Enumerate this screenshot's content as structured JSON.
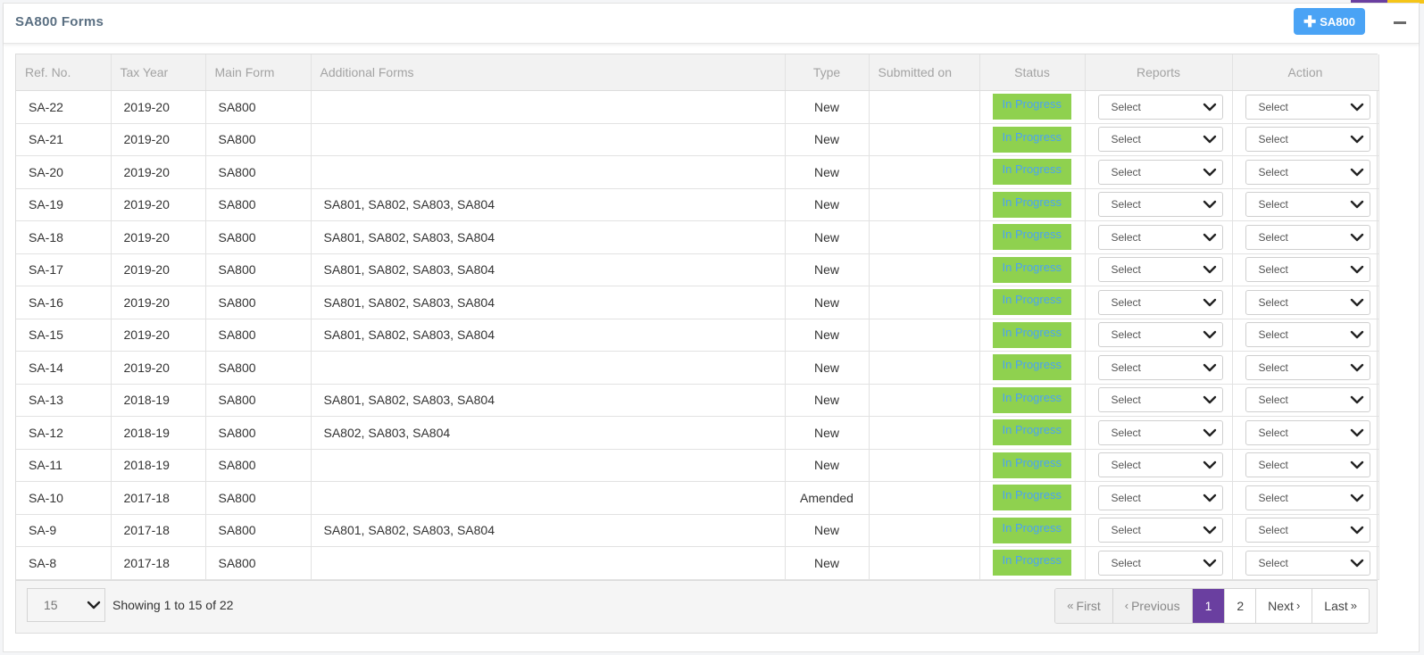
{
  "panel": {
    "title": "SA800 Forms",
    "add_button_label": "SA800"
  },
  "table": {
    "headers": {
      "ref": "Ref. No.",
      "tax_year": "Tax Year",
      "main_form": "Main Form",
      "additional": "Additional Forms",
      "type": "Type",
      "submitted": "Submitted on",
      "status": "Status",
      "reports": "Reports",
      "action": "Action"
    },
    "rows": [
      {
        "ref": "SA-22",
        "year": "2019-20",
        "main": "SA800",
        "additional": "",
        "type": "New",
        "submitted": "",
        "status": "In Progress",
        "reports": "Select",
        "action": "Select"
      },
      {
        "ref": "SA-21",
        "year": "2019-20",
        "main": "SA800",
        "additional": "",
        "type": "New",
        "submitted": "",
        "status": "In Progress",
        "reports": "Select",
        "action": "Select"
      },
      {
        "ref": "SA-20",
        "year": "2019-20",
        "main": "SA800",
        "additional": "",
        "type": "New",
        "submitted": "",
        "status": "In Progress",
        "reports": "Select",
        "action": "Select"
      },
      {
        "ref": "SA-19",
        "year": "2019-20",
        "main": "SA800",
        "additional": "SA801, SA802, SA803, SA804",
        "type": "New",
        "submitted": "",
        "status": "In Progress",
        "reports": "Select",
        "action": "Select"
      },
      {
        "ref": "SA-18",
        "year": "2019-20",
        "main": "SA800",
        "additional": "SA801, SA802, SA803, SA804",
        "type": "New",
        "submitted": "",
        "status": "In Progress",
        "reports": "Select",
        "action": "Select"
      },
      {
        "ref": "SA-17",
        "year": "2019-20",
        "main": "SA800",
        "additional": "SA801, SA802, SA803, SA804",
        "type": "New",
        "submitted": "",
        "status": "In Progress",
        "reports": "Select",
        "action": "Select"
      },
      {
        "ref": "SA-16",
        "year": "2019-20",
        "main": "SA800",
        "additional": "SA801, SA802, SA803, SA804",
        "type": "New",
        "submitted": "",
        "status": "In Progress",
        "reports": "Select",
        "action": "Select"
      },
      {
        "ref": "SA-15",
        "year": "2019-20",
        "main": "SA800",
        "additional": "SA801, SA802, SA803, SA804",
        "type": "New",
        "submitted": "",
        "status": "In Progress",
        "reports": "Select",
        "action": "Select"
      },
      {
        "ref": "SA-14",
        "year": "2019-20",
        "main": "SA800",
        "additional": "",
        "type": "New",
        "submitted": "",
        "status": "In Progress",
        "reports": "Select",
        "action": "Select"
      },
      {
        "ref": "SA-13",
        "year": "2018-19",
        "main": "SA800",
        "additional": "SA801, SA802, SA803, SA804",
        "type": "New",
        "submitted": "",
        "status": "In Progress",
        "reports": "Select",
        "action": "Select"
      },
      {
        "ref": "SA-12",
        "year": "2018-19",
        "main": "SA800",
        "additional": "SA802, SA803, SA804",
        "type": "New",
        "submitted": "",
        "status": "In Progress",
        "reports": "Select",
        "action": "Select"
      },
      {
        "ref": "SA-11",
        "year": "2018-19",
        "main": "SA800",
        "additional": "",
        "type": "New",
        "submitted": "",
        "status": "In Progress",
        "reports": "Select",
        "action": "Select"
      },
      {
        "ref": "SA-10",
        "year": "2017-18",
        "main": "SA800",
        "additional": "",
        "type": "Amended",
        "submitted": "",
        "status": "In Progress",
        "reports": "Select",
        "action": "Select"
      },
      {
        "ref": "SA-9",
        "year": "2017-18",
        "main": "SA800",
        "additional": "SA801, SA802, SA803, SA804",
        "type": "New",
        "submitted": "",
        "status": "In Progress",
        "reports": "Select",
        "action": "Select"
      },
      {
        "ref": "SA-8",
        "year": "2017-18",
        "main": "SA800",
        "additional": "",
        "type": "New",
        "submitted": "",
        "status": "In Progress",
        "reports": "Select",
        "action": "Select"
      }
    ]
  },
  "footer": {
    "page_size": "15",
    "showing": "Showing 1 to 15 of 22",
    "pagination": {
      "first": "First",
      "previous": "Previous",
      "pages": [
        "1",
        "2"
      ],
      "current_page": "1",
      "next": "Next",
      "last": "Last"
    }
  },
  "icons": {
    "add": "plus-icon",
    "collapse": "minus-icon",
    "dropdown": "chevron-down-icon",
    "first": "double-chevron-left-icon",
    "previous": "chevron-left-icon",
    "next": "chevron-right-icon",
    "last": "double-chevron-right-icon"
  },
  "colors": {
    "accent_blue": "#4aa3f5",
    "status_green": "#8fd14f",
    "active_page": "#6a3fa0",
    "title": "#5a6f82",
    "corner_purple": "#6a3fa0",
    "corner_yellow": "#f5c518"
  }
}
